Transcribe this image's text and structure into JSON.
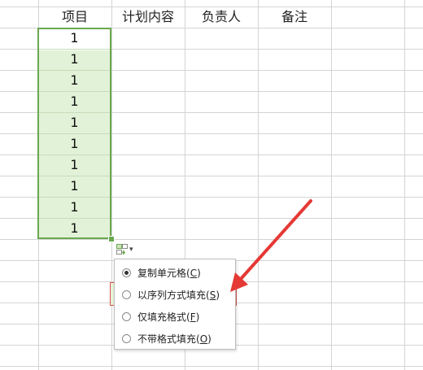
{
  "headers": [
    "项目",
    "计划内容",
    "负责人",
    "备注"
  ],
  "column_a_values": [
    "1",
    "1",
    "1",
    "1",
    "1",
    "1",
    "1",
    "1",
    "1",
    "1"
  ],
  "autofill": {
    "icon": "autofill-options-icon",
    "caret": "▾",
    "options": [
      {
        "label": "复制单元格",
        "key": "C",
        "checked": true
      },
      {
        "label": "以序列方式填充",
        "key": "S",
        "checked": false
      },
      {
        "label": "仅填充格式",
        "key": "F",
        "checked": false
      },
      {
        "label": "不带格式填充",
        "key": "O",
        "checked": false
      }
    ]
  },
  "colors": {
    "selection_border": "#6aa84f",
    "selection_fill": "#e2f2d8",
    "annotation": "#e53935"
  }
}
